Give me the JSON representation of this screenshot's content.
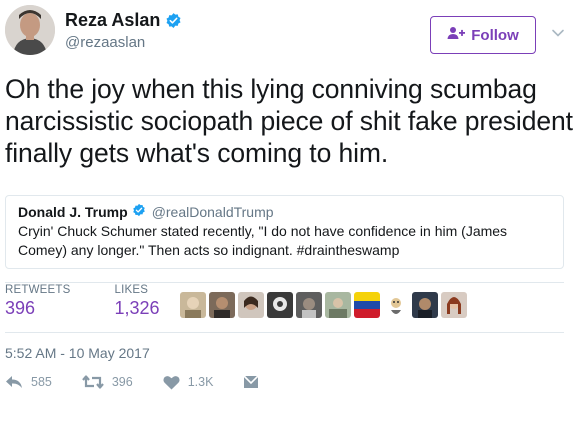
{
  "author": {
    "name": "Reza Aslan",
    "handle": "@rezaaslan",
    "avatar_icon": "author-avatar"
  },
  "follow_button": {
    "label": "Follow",
    "icon": "add-user-icon"
  },
  "tweet": {
    "text": "Oh the joy when this lying conniving scumbag narcissistic sociopath piece of shit fake president finally gets what's coming to him."
  },
  "quoted_tweet": {
    "name": "Donald J. Trump",
    "handle": "@realDonaldTrump",
    "text": "Cryin' Chuck Schumer stated recently, \"I do not have confidence in him (James Comey) any longer.\" Then acts so indignant.  #draintheswamp"
  },
  "stats": {
    "retweets_label": "RETWEETS",
    "retweets_value": "396",
    "likes_label": "LIKES",
    "likes_value": "1,326"
  },
  "timestamp": "5:52 AM - 10 May 2017",
  "actions": {
    "reply_count": "585",
    "retweet_count": "396",
    "like_count": "1.3K"
  },
  "colors": {
    "accent": "#7b3fb8",
    "verified": "#1da1f2",
    "muted": "#657786",
    "action_icon": "#8899a6"
  }
}
